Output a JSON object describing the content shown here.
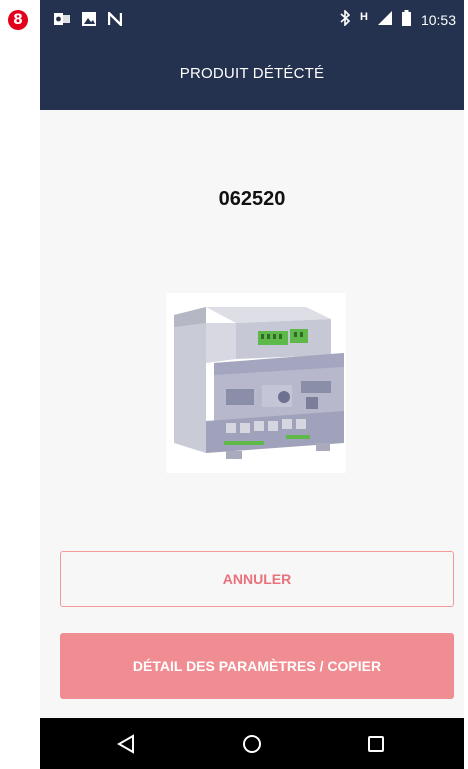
{
  "step_badge": "8",
  "status_bar": {
    "time": "10:53",
    "network": "H",
    "left_icons": [
      "outlook-icon",
      "image-icon",
      "nfc-icon"
    ],
    "right_icons": [
      "bluetooth-icon",
      "signal-icon",
      "battery-icon"
    ]
  },
  "header": {
    "title": "PRODUIT DÉTÉCTÉ"
  },
  "product": {
    "code": "062520"
  },
  "buttons": {
    "cancel_label": "ANNULER",
    "detail_label": "DÉTAIL DES PARAMÈTRES / COPIER"
  },
  "nav_bar": {
    "items": [
      "back-icon",
      "home-icon",
      "recents-icon"
    ]
  },
  "colors": {
    "header_bg": "#25324f",
    "accent": "#f08d92",
    "cancel_text": "#e8727b"
  }
}
